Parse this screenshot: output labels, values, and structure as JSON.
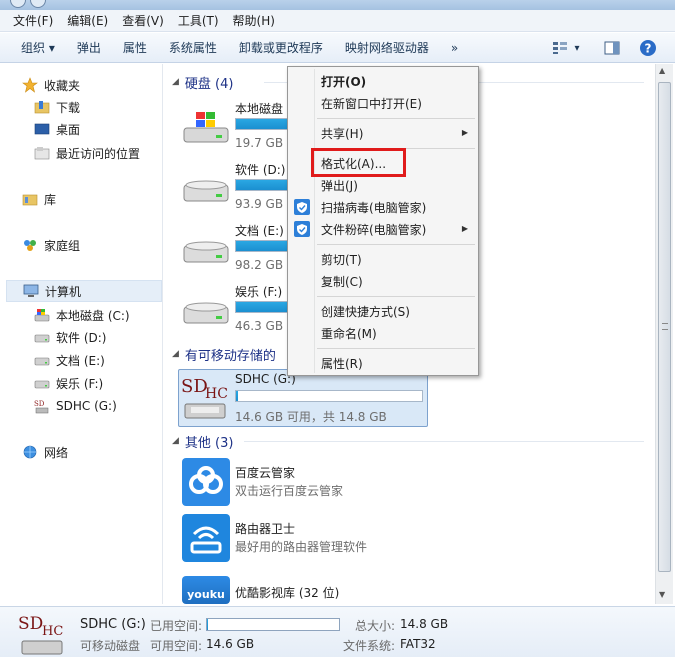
{
  "menubar": [
    "文件(F)",
    "编辑(E)",
    "查看(V)",
    "工具(T)",
    "帮助(H)"
  ],
  "toolbar": {
    "organize": "组织 ▾",
    "eject": "弹出",
    "properties": "属性",
    "system_properties": "系统属性",
    "uninstall": "卸载或更改程序",
    "map_drive": "映射网络驱动器",
    "more": "»",
    "view_toggle": "▾"
  },
  "nav": {
    "favorites": "收藏夹",
    "downloads": "下载",
    "desktop": "桌面",
    "recent": "最近访问的位置",
    "libraries": "库",
    "homegroup": "家庭组",
    "computer": "计算机",
    "drive_c": "本地磁盘 (C:)",
    "drive_d": "软件 (D:)",
    "drive_e": "文档 (E:)",
    "drive_f": "娱乐 (F:)",
    "drive_g": "SDHC (G:)",
    "network": "网络"
  },
  "groups": {
    "hard_disks": "硬盘 (4)",
    "removable": "有可移动存储的",
    "other": "其他 (3)"
  },
  "drives": [
    {
      "name": "本地磁盘",
      "free": "19.7 GB",
      "usage": 0.65
    },
    {
      "name": "软件 (D:)",
      "free": "93.9 GB",
      "usage": 0.55
    },
    {
      "name": "文档 (E:)",
      "free": "98.2 GB",
      "usage": 0.5
    },
    {
      "name": "娱乐 (F:)",
      "free": "46.3 GB",
      "usage": 0.75
    }
  ],
  "sdhc": {
    "name": "SDHC (G:)",
    "free": "14.6 GB 可用，共 14.8 GB",
    "usage": 0.01,
    "logo_text": "SDHC"
  },
  "apps": [
    {
      "name": "百度云管家",
      "desc": "双击运行百度云管家"
    },
    {
      "name": "路由器卫士",
      "desc": "最好用的路由器管理软件"
    },
    {
      "name": "优酷影视库 (32 位)",
      "desc": "",
      "logo_text": "youku"
    }
  ],
  "context_menu": {
    "open": "打开(O)",
    "open_new_window": "在新窗口中打开(E)",
    "share": "共享(H)",
    "format": "格式化(A)...",
    "eject": "弹出(J)",
    "scan": "扫描病毒(电脑管家)",
    "shred": "文件粉碎(电脑管家)",
    "cut": "剪切(T)",
    "copy": "复制(C)",
    "create_shortcut": "创建快捷方式(S)",
    "rename": "重命名(M)",
    "properties": "属性(R)"
  },
  "details": {
    "name": "SDHC (G:)",
    "type": "可移动磁盘",
    "used_label": "已用空间:",
    "free_label": "可用空间:",
    "free_value": "14.6 GB",
    "total_label": "总大小:",
    "total_value": "14.8 GB",
    "fs_label": "文件系统:",
    "fs_value": "FAT32",
    "usage": 0.01
  },
  "colors": {
    "accent": "#1b8fd0",
    "highlight": "#e01b1b"
  }
}
